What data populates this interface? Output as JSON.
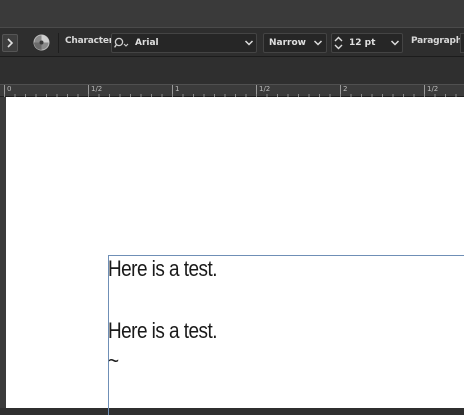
{
  "control_bar": {
    "character_label": "Character:",
    "font_family": "Arial",
    "font_style": "Narrow",
    "font_size": "12 pt",
    "paragraph_label": "Paragraph:"
  },
  "ruler": {
    "labels": [
      "0",
      "1/2",
      "1",
      "1/2",
      "2",
      "1/2"
    ]
  },
  "document": {
    "lines": [
      "Here is a test.",
      "Here is a test.",
      "~"
    ]
  },
  "colors": {
    "frame_border": "#6f8fb6",
    "app_background": "#2f2f2f",
    "canvas": "#ffffff"
  }
}
